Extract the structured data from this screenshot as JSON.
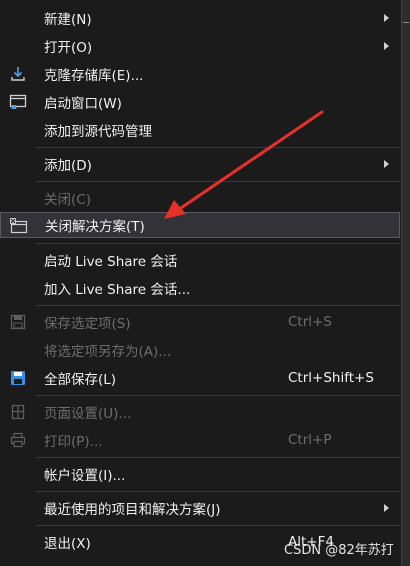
{
  "menu": {
    "items": [
      {
        "label": "新建(N)",
        "submenu": true
      },
      {
        "label": "打开(O)",
        "submenu": true
      },
      {
        "label": "克隆存储库(E)...",
        "icon": "download-arrow-icon"
      },
      {
        "label": "启动窗口(W)",
        "icon": "start-window-icon"
      },
      {
        "label": "添加到源代码管理"
      },
      {
        "label": "添加(D)",
        "submenu": true
      },
      {
        "label": "关闭(C)",
        "disabled": true
      },
      {
        "label": "关闭解决方案(T)",
        "icon": "close-solution-icon",
        "highlighted": true
      },
      {
        "label": "启动 Live Share 会话"
      },
      {
        "label": "加入 Live Share 会话..."
      },
      {
        "label": "保存选定项(S)",
        "shortcut": "Ctrl+S",
        "disabled": true,
        "icon": "save-icon"
      },
      {
        "label": "将选定项另存为(A)...",
        "disabled": true
      },
      {
        "label": "全部保存(L)",
        "shortcut": "Ctrl+Shift+S",
        "icon": "save-all-icon"
      },
      {
        "label": "页面设置(U)...",
        "disabled": true,
        "icon": "page-setup-icon"
      },
      {
        "label": "打印(P)...",
        "shortcut": "Ctrl+P",
        "disabled": true,
        "icon": "printer-icon"
      },
      {
        "label": "帐户设置(I)..."
      },
      {
        "label": "最近使用的项目和解决方案(J)",
        "submenu": true
      },
      {
        "label": "退出(X)",
        "shortcut": "Alt+F4"
      }
    ]
  },
  "colors": {
    "accent": "#e8302a",
    "save_blue": "#3c8fe0"
  },
  "watermark": "CSDN @82年苏打"
}
